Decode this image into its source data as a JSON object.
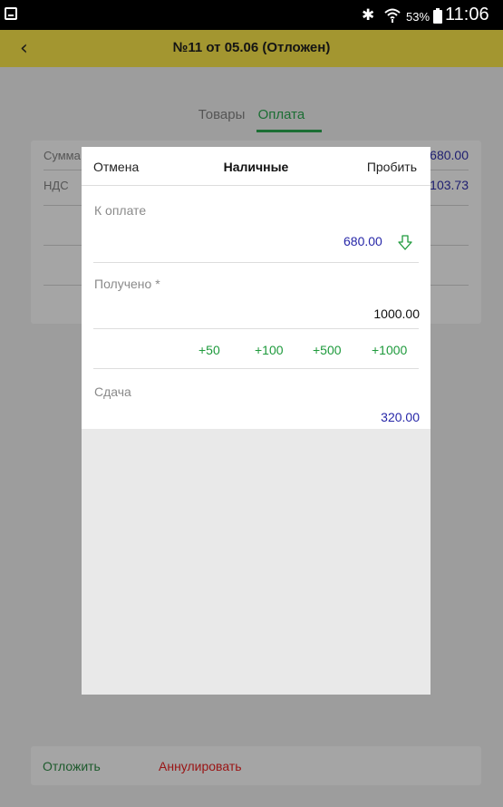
{
  "statusbar": {
    "battery_percent": "53%",
    "time": "11:06",
    "bluetooth_icon": "bluetooth-icon",
    "wifi_icon": "wifi-icon"
  },
  "header": {
    "title": "№11 от 05.06 (Отложен)",
    "back_icon": "back-icon"
  },
  "tabs": [
    {
      "label": "Товары",
      "active": false
    },
    {
      "label": "Оплата",
      "active": true
    }
  ],
  "summary": {
    "sum_label": "Сумма",
    "sum_value": "680.00",
    "vat_label": "НДС",
    "vat_value": "103.73"
  },
  "modal": {
    "cancel_label": "Отмена",
    "title": "Наличные",
    "submit_label": "Пробить",
    "to_pay_label": "К оплате",
    "to_pay_value": "680.00",
    "received_label": "Получено *",
    "received_value": "1000.00",
    "quick_amounts": [
      "+50",
      "+100",
      "+500",
      "+1000"
    ],
    "change_label": "Сдача",
    "change_value": "320.00"
  },
  "bottom": {
    "postpone_label": "Отложить",
    "annul_label": "Аннулировать"
  },
  "colors": {
    "accent_green": "#1e9a3c",
    "value_blue": "#2727a8",
    "header_yellow": "#e8d645",
    "danger_red": "#d21e1e"
  }
}
